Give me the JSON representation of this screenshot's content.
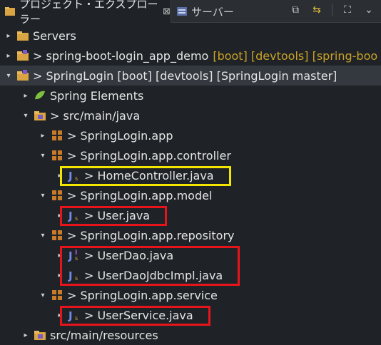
{
  "tabs": [
    {
      "label": "プロジェクト・エクスプローラー",
      "close": "⊠",
      "icon": "project-explorer-icon"
    },
    {
      "label": "サーバー",
      "icon": "servers-view-icon"
    }
  ],
  "toolbar": [
    {
      "name": "collapse-all-icon",
      "glyph": "⧉"
    },
    {
      "name": "link-with-editor-icon",
      "glyph": "⇆"
    },
    {
      "name": "focus-icon",
      "glyph": "⛶"
    },
    {
      "name": "view-menu-icon",
      "glyph": "⌄"
    }
  ],
  "tree": [
    {
      "depth": 0,
      "twisty": "▸",
      "icon": "folder-icon",
      "label": "Servers",
      "decoration": ""
    },
    {
      "depth": 0,
      "twisty": "▸",
      "icon": "project-icon",
      "label": "> spring-boot-login_app_demo",
      "decoration": "[boot] [devtools] [spring-boo"
    },
    {
      "depth": 0,
      "twisty": "▾",
      "icon": "project-icon",
      "label": "> SpringLogin [boot] [devtools] [SpringLogin master]",
      "decoration": "",
      "selected": true
    },
    {
      "depth": 1,
      "twisty": "▸",
      "icon": "spring-elements-icon",
      "label": "Spring Elements",
      "decoration": ""
    },
    {
      "depth": 1,
      "twisty": "▾",
      "icon": "source-folder-icon",
      "label": "> src/main/java",
      "decoration": ""
    },
    {
      "depth": 2,
      "twisty": "▸",
      "icon": "package-icon",
      "label": "> SpringLogin.app",
      "decoration": ""
    },
    {
      "depth": 2,
      "twisty": "▾",
      "icon": "package-icon",
      "label": "> SpringLogin.app.controller",
      "decoration": ""
    },
    {
      "depth": 3,
      "twisty": "▸",
      "icon": "java-file-icon",
      "label": "> HomeController.java",
      "decoration": "",
      "highlight": "yellow"
    },
    {
      "depth": 2,
      "twisty": "▾",
      "icon": "package-icon",
      "label": "> SpringLogin.app.model",
      "decoration": ""
    },
    {
      "depth": 3,
      "twisty": "▸",
      "icon": "java-file-icon",
      "label": "> User.java",
      "decoration": "",
      "highlight": "red"
    },
    {
      "depth": 2,
      "twisty": "▾",
      "icon": "package-icon",
      "label": "> SpringLogin.app.repository",
      "decoration": ""
    },
    {
      "depth": 3,
      "twisty": "▸",
      "icon": "java-interface-icon",
      "label": "> UserDao.java",
      "decoration": ""
    },
    {
      "depth": 3,
      "twisty": "▸",
      "icon": "java-file-icon",
      "label": "> UserDaoJdbcImpl.java",
      "decoration": ""
    },
    {
      "depth": 2,
      "twisty": "▾",
      "icon": "package-icon",
      "label": "> SpringLogin.app.service",
      "decoration": ""
    },
    {
      "depth": 3,
      "twisty": "▸",
      "icon": "java-file-icon",
      "label": "> UserService.java",
      "decoration": "",
      "highlight": "red"
    },
    {
      "depth": 1,
      "twisty": "▸",
      "icon": "source-folder-icon",
      "label": "src/main/resources",
      "decoration": ""
    }
  ],
  "highlight_groups": [
    {
      "color": "yellow",
      "rows": [
        7,
        7
      ]
    },
    {
      "color": "red",
      "rows": [
        9,
        9
      ]
    },
    {
      "color": "red",
      "rows": [
        11,
        12
      ]
    },
    {
      "color": "red",
      "rows": [
        14,
        14
      ]
    }
  ],
  "colors": {
    "background": "#1f2327",
    "decoration": "#c9a227",
    "highlight_yellow": "#f2e600",
    "highlight_red": "#e8141c",
    "selection": "#33393f"
  }
}
